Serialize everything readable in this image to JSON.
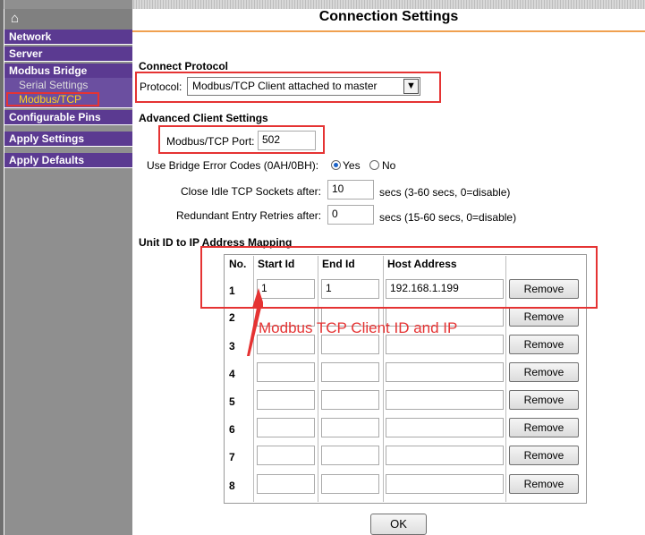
{
  "sidebar": {
    "home_icon": "home-icon",
    "items": [
      {
        "label": "Network"
      },
      {
        "label": "Server"
      },
      {
        "label": "Modbus Bridge"
      },
      {
        "label": "Serial Settings"
      },
      {
        "label": "Modbus/TCP"
      },
      {
        "label": "Configurable Pins"
      },
      {
        "label": "Apply Settings"
      },
      {
        "label": "Apply Defaults"
      }
    ]
  },
  "header": {
    "title": "Connection Settings"
  },
  "connect": {
    "section": "Connect Protocol",
    "protocol_label": "Protocol:",
    "protocol_value": "Modbus/TCP Client attached to master"
  },
  "advanced": {
    "section": "Advanced Client Settings",
    "port_label": "Modbus/TCP Port:",
    "port_value": "502",
    "error_codes_label": "Use Bridge Error Codes (0AH/0BH):",
    "yes": "Yes",
    "no": "No",
    "close_idle_label": "Close Idle TCP Sockets after:",
    "close_idle_value": "10",
    "close_idle_unit": "secs (3-60 secs, 0=disable)",
    "retries_label": "Redundant Entry Retries after:",
    "retries_value": "0",
    "retries_unit": "secs (15-60 secs, 0=disable)"
  },
  "mapping": {
    "section": "Unit ID to IP Address Mapping",
    "headers": [
      "No.",
      "Start Id",
      "End Id",
      "Host Address"
    ],
    "rows": [
      {
        "no": "1",
        "start": "1",
        "end": "1",
        "host": "192.168.1.199",
        "remove": "Remove"
      },
      {
        "no": "2",
        "start": "",
        "end": "",
        "host": "",
        "remove": "Remove"
      },
      {
        "no": "3",
        "start": "",
        "end": "",
        "host": "",
        "remove": "Remove"
      },
      {
        "no": "4",
        "start": "",
        "end": "",
        "host": "",
        "remove": "Remove"
      },
      {
        "no": "5",
        "start": "",
        "end": "",
        "host": "",
        "remove": "Remove"
      },
      {
        "no": "6",
        "start": "",
        "end": "",
        "host": "",
        "remove": "Remove"
      },
      {
        "no": "7",
        "start": "",
        "end": "",
        "host": "",
        "remove": "Remove"
      },
      {
        "no": "8",
        "start": "",
        "end": "",
        "host": "",
        "remove": "Remove"
      }
    ]
  },
  "annotation": "Modbus TCP Client ID and IP",
  "ok_label": "OK",
  "colors": {
    "nav_bg": "#5b3a91",
    "active": "#ffd21e",
    "highlight": "#e53333",
    "rule": "#f0a050"
  }
}
